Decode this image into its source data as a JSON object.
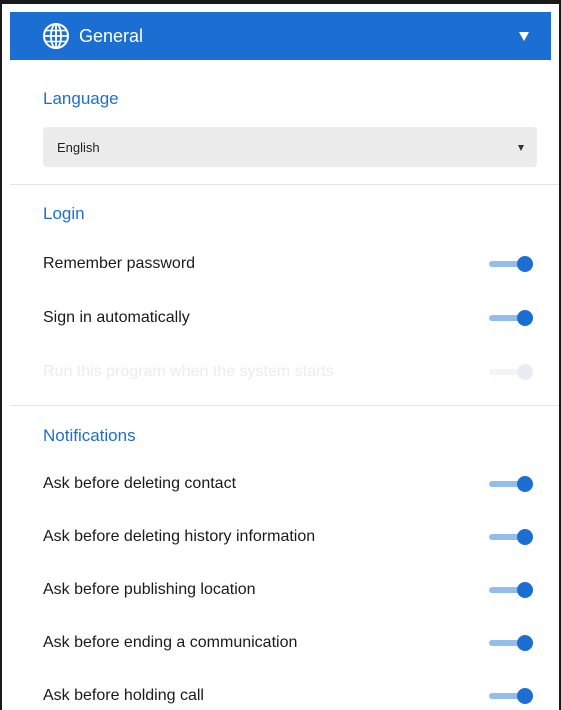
{
  "header": {
    "title": "General",
    "icon": "globe-icon",
    "accent": "#1c6fd2"
  },
  "language": {
    "title": "Language",
    "selected": "English"
  },
  "login": {
    "title": "Login",
    "items": [
      {
        "label": "Remember password",
        "on": true,
        "enabled": true
      },
      {
        "label": "Sign in automatically",
        "on": true,
        "enabled": true
      },
      {
        "label": "Run this program when the system starts",
        "on": true,
        "enabled": false
      }
    ]
  },
  "notifications": {
    "title": "Notifications",
    "items": [
      {
        "label": "Ask before deleting contact",
        "on": true,
        "enabled": true
      },
      {
        "label": "Ask before deleting history information",
        "on": true,
        "enabled": true
      },
      {
        "label": "Ask before publishing location",
        "on": true,
        "enabled": true
      },
      {
        "label": "Ask before ending a communication",
        "on": true,
        "enabled": true
      },
      {
        "label": "Ask before holding call",
        "on": true,
        "enabled": true
      }
    ]
  }
}
